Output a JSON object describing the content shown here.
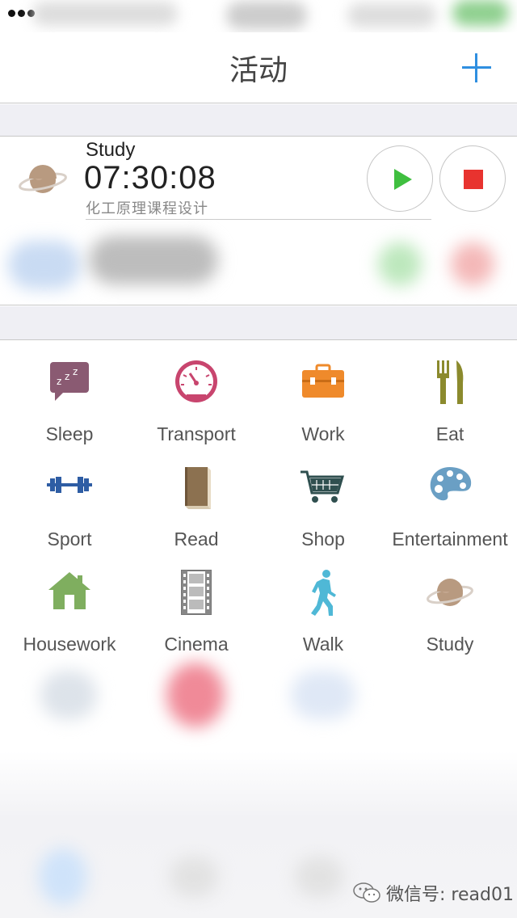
{
  "nav": {
    "title": "活动",
    "add_icon": "plus-icon"
  },
  "active": {
    "name": "Study",
    "timer": "07:30:08",
    "note": "化工原理课程设计",
    "icon": "planet-icon",
    "play_icon": "play-icon",
    "stop_icon": "stop-icon",
    "accent_play": "#3fbf3f",
    "accent_stop": "#e8332f"
  },
  "categories": [
    {
      "label": "Sleep",
      "icon": "sleep-bubble-icon",
      "color": "#8a5a72"
    },
    {
      "label": "Transport",
      "icon": "speedometer-icon",
      "color": "#c8456e"
    },
    {
      "label": "Work",
      "icon": "toolbox-icon",
      "color": "#ef8a2b"
    },
    {
      "label": "Eat",
      "icon": "fork-knife-icon",
      "color": "#8b8a2d"
    },
    {
      "label": "Sport",
      "icon": "dumbbell-icon",
      "color": "#2e5da4"
    },
    {
      "label": "Read",
      "icon": "book-icon",
      "color": "#8c7150"
    },
    {
      "label": "Shop",
      "icon": "cart-icon",
      "color": "#2f4f4f"
    },
    {
      "label": "Entertainment",
      "icon": "palette-icon",
      "color": "#6a9fc4"
    },
    {
      "label": "Housework",
      "icon": "house-icon",
      "color": "#7fae5f"
    },
    {
      "label": "Cinema",
      "icon": "film-icon",
      "color": "#777777"
    },
    {
      "label": "Walk",
      "icon": "walker-icon",
      "color": "#4fb8d6"
    },
    {
      "label": "Study",
      "icon": "planet-icon",
      "color": "#b89a80"
    }
  ],
  "watermark": {
    "text": "微信号: read01",
    "icon": "wechat-icon"
  }
}
